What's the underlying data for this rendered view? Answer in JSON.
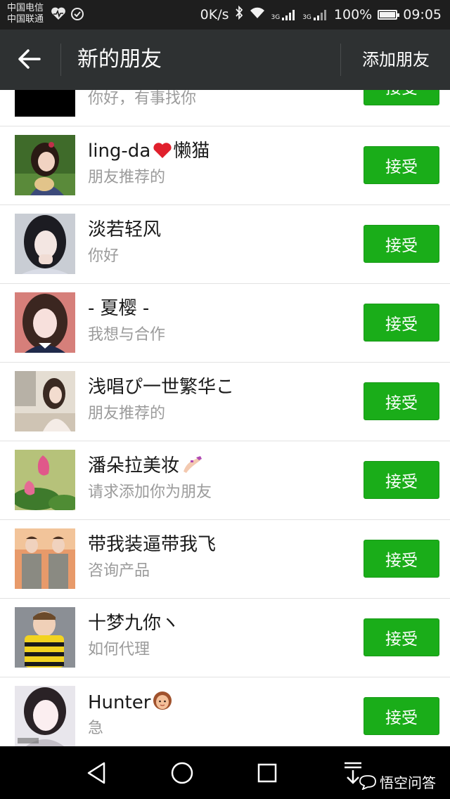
{
  "status_bar": {
    "carrier_1": "中国电信",
    "carrier_2": "中国联通",
    "speed": "0K/s",
    "net_1": "3G",
    "net_2": "3G",
    "battery": "100%",
    "time": "09:05"
  },
  "header": {
    "title": "新的朋友",
    "add_friend": "添加朋友"
  },
  "requests": [
    {
      "name": "",
      "message": "你好，有事找你",
      "button": "接受",
      "avatar": "black-square"
    },
    {
      "name": "ling-da",
      "name_suffix": "懒猫",
      "name_emoji": "red-heart",
      "message": "朋友推荐的",
      "button": "接受",
      "avatar": "girl-with-hat"
    },
    {
      "name": "淡若轻风",
      "message": "你好",
      "button": "接受",
      "avatar": "girl-dark-hair"
    },
    {
      "name": "- 夏樱 -",
      "message": "我想与合作",
      "button": "接受",
      "avatar": "girl-long-hair"
    },
    {
      "name": "浅唱ぴ一世繁华こ",
      "message": "朋友推荐的",
      "button": "接受",
      "avatar": "girl-in-room"
    },
    {
      "name": "潘朵拉美妆",
      "name_emoji": "nail-polish",
      "message": "请求添加你为朋友",
      "button": "接受",
      "avatar": "lotus-flower"
    },
    {
      "name": "带我装逼带我飞",
      "message": "咨询产品",
      "button": "接受",
      "avatar": "two-men"
    },
    {
      "name": "十梦九你ヽ",
      "message": "如何代理",
      "button": "接受",
      "avatar": "boy-with-bee-shirt"
    },
    {
      "name": "Hunter",
      "name_emoji": "woman-face",
      "message": "急",
      "button": "接受",
      "avatar": "girl-pale"
    }
  ],
  "watermark": "悟空问答",
  "colors": {
    "status_bar": "#1e1e1e",
    "title_bar": "#2e3132",
    "accept_button": "#1aad19",
    "secondary_text": "#9b9b9b"
  }
}
